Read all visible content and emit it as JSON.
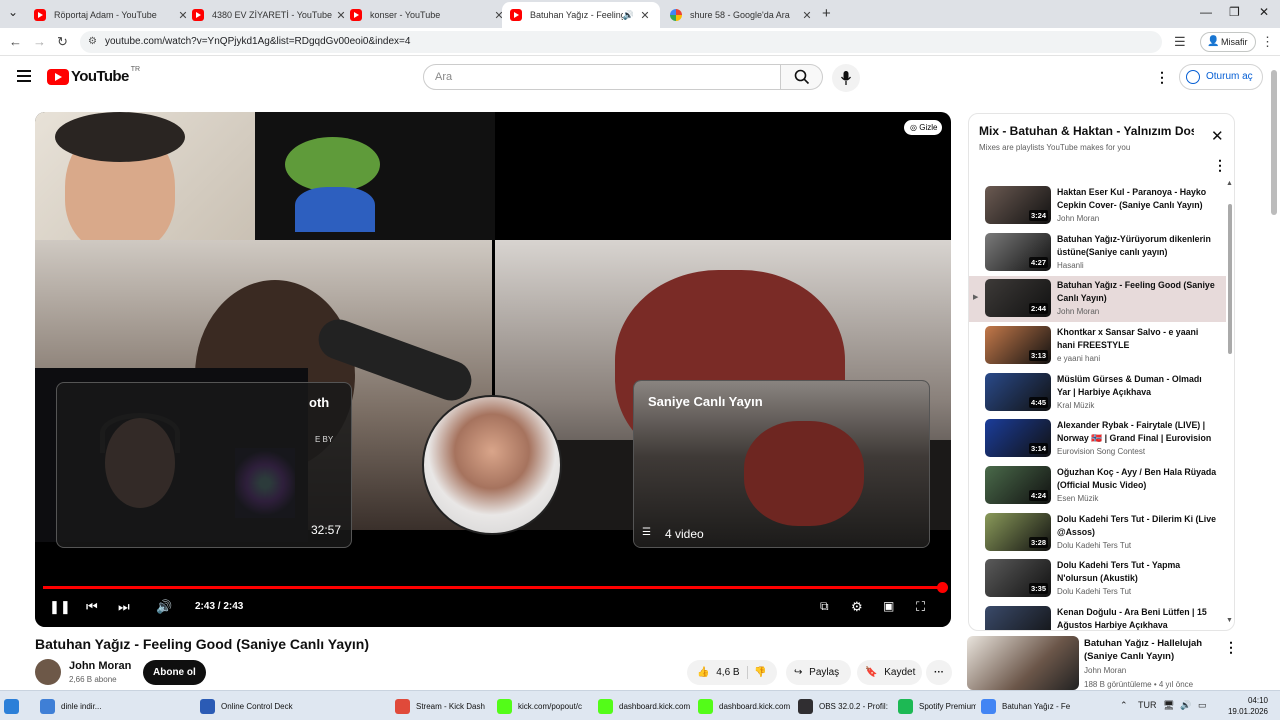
{
  "browser": {
    "tabs": [
      {
        "title": "Röportaj Adam - YouTube",
        "icon": "youtube"
      },
      {
        "title": "4380 EV ZİYARETİ - YouTube",
        "icon": "youtube"
      },
      {
        "title": "konser - YouTube",
        "icon": "youtube"
      },
      {
        "title": "Batuhan Yağız - Feeling Goo",
        "icon": "youtube",
        "active": true,
        "audio": true
      },
      {
        "title": "shure 58 - Google'da Ara",
        "icon": "google"
      }
    ],
    "url": "youtube.com/watch?v=YnQPjykd1Ag&list=RDgqdGv00eoi0&index=4",
    "profile_label": "Misafir"
  },
  "header": {
    "logo_text": "YouTube",
    "country_code": "TR",
    "search_placeholder": "Ara",
    "signin_label": "Oturum aç"
  },
  "player": {
    "hide_badge": "Gizle",
    "overlay_left_title": "oth",
    "overlay_left_caption": "E BY",
    "overlay_left_duration": "32:57",
    "overlay_right_title": "Saniye Canlı Yayın",
    "overlay_right_count": "4 video",
    "time": "2:43 / 2:43",
    "progress": 1.0
  },
  "video": {
    "title": "Batuhan Yağız - Feeling Good (Saniye Canlı Yayın)",
    "channel": "John Moran",
    "subscribers": "2,66 B abone",
    "subscribe_label": "Abone ol",
    "likes": "4,6 B",
    "share_label": "Paylaş",
    "save_label": "Kaydet"
  },
  "playlist": {
    "title": "Mix - Batuhan & Haktan - Yalnızım Dostum",
    "subtitle": "Mixes are playlists YouTube makes for you",
    "items": [
      {
        "title": "Haktan Eser Kul - Paranoya - Hayko Cepkin Cover- (Saniye Canlı Yayın)",
        "channel": "John Moran",
        "duration": "3:24",
        "thumb": "#6b5a52"
      },
      {
        "title": "Batuhan Yağız-Yürüyorum dikenlerin üstüne(Saniye canlı yayın)",
        "channel": "Hasanli",
        "duration": "4:27",
        "thumb": "#7a7a7a"
      },
      {
        "title": "Batuhan Yağız - Feeling Good (Saniye Canlı Yayın)",
        "channel": "John Moran",
        "duration": "2:44",
        "thumb": "#3d3a38",
        "current": true
      },
      {
        "title": "Khontkar x Sansar Salvo - e yaani hani FREESTYLE",
        "channel": "e yaani hani",
        "duration": "3:13",
        "thumb": "#c4794a"
      },
      {
        "title": "Müslüm Gürses & Duman - Olmadı Yar | Harbiye Açıkhava",
        "channel": "Kral Müzik",
        "duration": "4:45",
        "thumb": "#2a4a8a"
      },
      {
        "title": "Alexander Rybak - Fairytale (LIVE) | Norway 🇳🇴 | Grand Final | Eurovision 2009",
        "channel": "Eurovision Song Contest",
        "duration": "3:14",
        "thumb": "#1b3d9b"
      },
      {
        "title": "Oğuzhan Koç - Ayy / Ben Hala Rüyada (Official Music Video)",
        "channel": "Esen Müzik",
        "duration": "4:24",
        "thumb": "#4a6a4a"
      },
      {
        "title": "Dolu Kadehi Ters Tut - Dilerim Ki (Live @Assos)",
        "channel": "Dolu Kadehi Ters Tut",
        "duration": "3:28",
        "thumb": "#8a9a5a"
      },
      {
        "title": "Dolu Kadehi Ters Tut - Yapma N'olursun (Akustik)",
        "channel": "Dolu Kadehi Ters Tut",
        "duration": "3:35",
        "thumb": "#5a5a5a"
      },
      {
        "title": "Kenan Doğulu - Ara Beni Lütfen | 15 Ağustos Harbiye Açıkhava",
        "channel": "",
        "duration": "",
        "thumb": "#3a4a6a"
      }
    ]
  },
  "recommended": {
    "title": "Batuhan Yağız - Hallelujah (Saniye Canlı Yayın)",
    "channel": "John Moran",
    "meta": "188 B görüntüleme • 4 yıl önce"
  },
  "taskbar": {
    "items": [
      {
        "label": "dinle indir...",
        "color": "#3f7fd6"
      },
      {
        "label": "Online Control Deck",
        "color": "#2b5bb5"
      },
      {
        "label": "Stream - Kick Dash",
        "color": "#e04a3a"
      },
      {
        "label": "kick.com/popout/c",
        "color": "#53fc18"
      },
      {
        "label": "dashboard.kick.com",
        "color": "#53fc18"
      },
      {
        "label": "dashboard.kick.com",
        "color": "#53fc18"
      },
      {
        "label": "OBS 32.0.2 - Profil:",
        "color": "#302e31"
      },
      {
        "label": "Spotify Premium",
        "color": "#1db954"
      },
      {
        "label": "Batuhan Yağız - Fe",
        "color": "#4285f4"
      }
    ],
    "lang": "TUR",
    "time": "04:10",
    "date": "19.01.2026"
  }
}
